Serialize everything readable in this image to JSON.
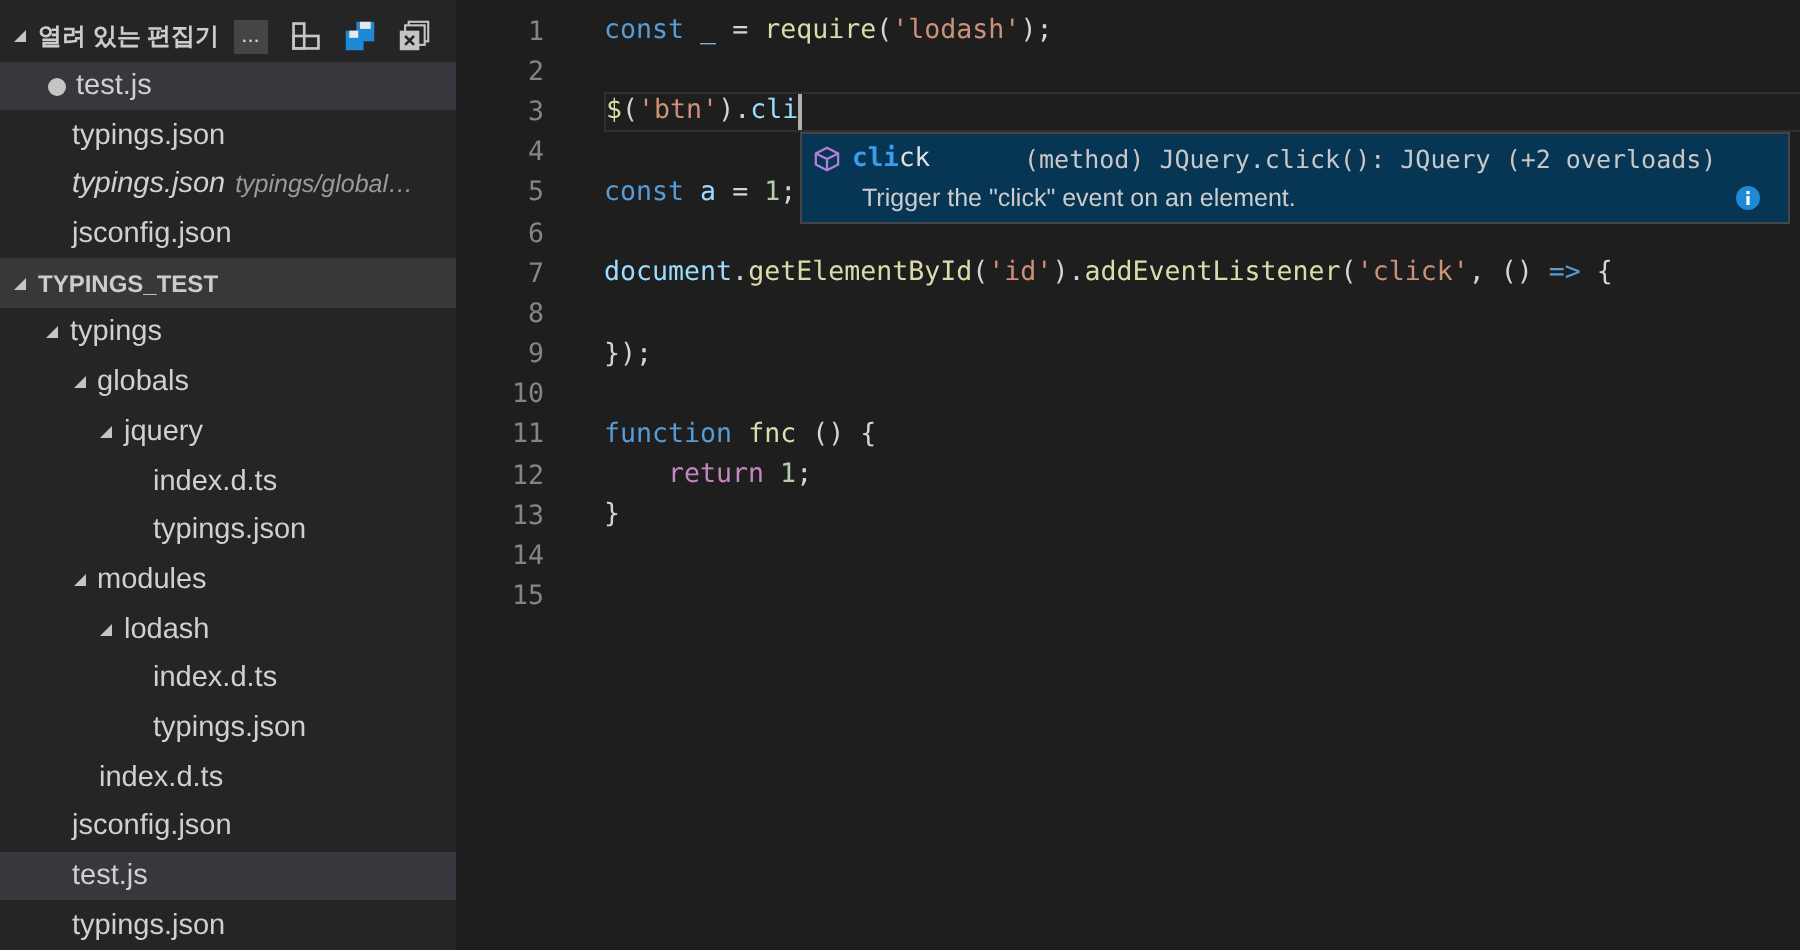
{
  "open_editors": {
    "title": "열려 있는 편집기",
    "expanded": true,
    "more_button": "...",
    "items": [
      {
        "name": "test.js",
        "dirty": true,
        "preview": false,
        "selected": true
      },
      {
        "name": "typings.json",
        "dirty": false,
        "preview": false,
        "selected": false
      },
      {
        "name": "typings.json",
        "description": "typings/global…",
        "dirty": false,
        "preview": true,
        "selected": false
      },
      {
        "name": "jsconfig.json",
        "dirty": false,
        "preview": false,
        "selected": false
      }
    ]
  },
  "explorer": {
    "title": "TYPINGS_TEST",
    "expanded": true,
    "tree": [
      {
        "name": "typings",
        "expanded": true,
        "selected": false,
        "children": [
          {
            "name": "globals",
            "expanded": true,
            "selected": false,
            "children": [
              {
                "name": "jquery",
                "expanded": true,
                "selected": false,
                "children": [
                  {
                    "name": "index.d.ts",
                    "selected": false
                  },
                  {
                    "name": "typings.json",
                    "selected": false
                  }
                ]
              }
            ]
          },
          {
            "name": "modules",
            "expanded": true,
            "selected": false,
            "children": [
              {
                "name": "lodash",
                "expanded": true,
                "selected": false,
                "children": [
                  {
                    "name": "index.d.ts",
                    "selected": false
                  },
                  {
                    "name": "typings.json",
                    "selected": false
                  }
                ]
              }
            ]
          },
          {
            "name": "index.d.ts",
            "selected": false
          }
        ]
      },
      {
        "name": "jsconfig.json",
        "selected": false
      },
      {
        "name": "test.js",
        "selected": true
      },
      {
        "name": "typings.json",
        "selected": false
      }
    ]
  },
  "editor": {
    "lines": [
      {
        "number": "1",
        "current": false,
        "tokens": [
          {
            "text": "const ",
            "kind": "keyword"
          },
          {
            "text": "_ ",
            "kind": "variable"
          },
          {
            "text": "= "
          },
          {
            "text": "require",
            "kind": "function"
          },
          {
            "text": "("
          },
          {
            "text": "'lodash'",
            "kind": "string"
          },
          {
            "text": ");"
          }
        ]
      },
      {
        "number": "2",
        "current": false
      },
      {
        "number": "3",
        "current": true,
        "tokens": [
          {
            "text": "$",
            "kind": "function"
          },
          {
            "text": "("
          },
          {
            "text": "'btn'",
            "kind": "string"
          },
          {
            "text": ")."
          },
          {
            "text": "cli",
            "kind": "variable"
          }
        ]
      },
      {
        "number": "4",
        "current": false
      },
      {
        "number": "5",
        "current": false,
        "tokens": [
          {
            "text": "const ",
            "kind": "keyword"
          },
          {
            "text": "a ",
            "kind": "variable"
          },
          {
            "text": "= "
          },
          {
            "text": "1",
            "kind": "number"
          },
          {
            "text": ";"
          }
        ]
      },
      {
        "number": "6",
        "current": false
      },
      {
        "number": "7",
        "current": false,
        "tokens": [
          {
            "text": "document",
            "kind": "variable"
          },
          {
            "text": "."
          },
          {
            "text": "getElementById",
            "kind": "function"
          },
          {
            "text": "("
          },
          {
            "text": "'id'",
            "kind": "string"
          },
          {
            "text": ")."
          },
          {
            "text": "addEventListener",
            "kind": "function"
          },
          {
            "text": "("
          },
          {
            "text": "'click'",
            "kind": "string"
          },
          {
            "text": ", () "
          },
          {
            "text": "=> ",
            "kind": "keyword"
          },
          {
            "text": "{"
          }
        ]
      },
      {
        "number": "8",
        "current": false
      },
      {
        "number": "9",
        "current": false,
        "tokens": [
          {
            "text": "});"
          }
        ]
      },
      {
        "number": "10",
        "current": false
      },
      {
        "number": "11",
        "current": false,
        "tokens": [
          {
            "text": "function ",
            "kind": "keyword"
          },
          {
            "text": "fnc ",
            "kind": "function"
          },
          {
            "text": "() {"
          }
        ]
      },
      {
        "number": "12",
        "current": false,
        "indented": true,
        "tokens": [
          {
            "text": "return ",
            "kind": "control"
          },
          {
            "text": "1",
            "kind": "number"
          },
          {
            "text": ";"
          }
        ]
      },
      {
        "number": "13",
        "current": false,
        "tokens": [
          {
            "text": "}"
          }
        ]
      },
      {
        "number": "14",
        "current": false
      },
      {
        "number": "15",
        "current": false
      }
    ],
    "suggestion": {
      "label": "**cli**ck",
      "detail": "(method) JQuery.click(): JQuery (+2 overloads)",
      "documentation": "Trigger the \"click\" event on an element."
    }
  }
}
